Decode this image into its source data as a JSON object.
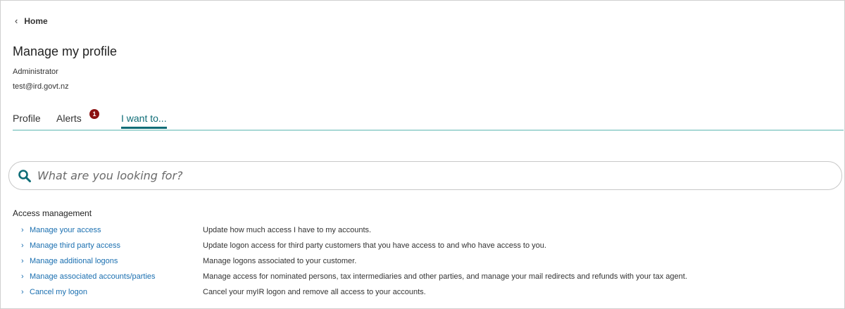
{
  "nav": {
    "back_label": "Home"
  },
  "header": {
    "title": "Manage my profile",
    "role": "Administrator",
    "email": "test@ird.govt.nz"
  },
  "tabs": [
    {
      "label": "Profile"
    },
    {
      "label": "Alerts",
      "badge": "1"
    },
    {
      "label": "I want to...",
      "active": true
    }
  ],
  "search": {
    "placeholder": "What are you looking for?"
  },
  "access_management": {
    "title": "Access management",
    "items": [
      {
        "label": "Manage your access",
        "description": "Update how much access I have to my accounts."
      },
      {
        "label": "Manage third party access",
        "description": "Update logon access for third party customers that you have access to and who have access to you."
      },
      {
        "label": "Manage additional logons",
        "description": "Manage logons associated to your customer."
      },
      {
        "label": "Manage associated accounts/parties",
        "description": "Manage access for nominated persons, tax intermediaries and other parties, and manage your mail redirects and refunds with your tax agent."
      },
      {
        "label": "Cancel my logon",
        "description": "Cancel your myIR logon and remove all access to your accounts."
      }
    ]
  },
  "colors": {
    "accent": "#0e6d77",
    "link": "#1a6fb0",
    "badge": "#8b1212",
    "tab_rule": "#a8d8d5"
  },
  "icons": {
    "back": "chevron-left-icon",
    "search": "search-icon",
    "row": "chevron-right-icon"
  }
}
